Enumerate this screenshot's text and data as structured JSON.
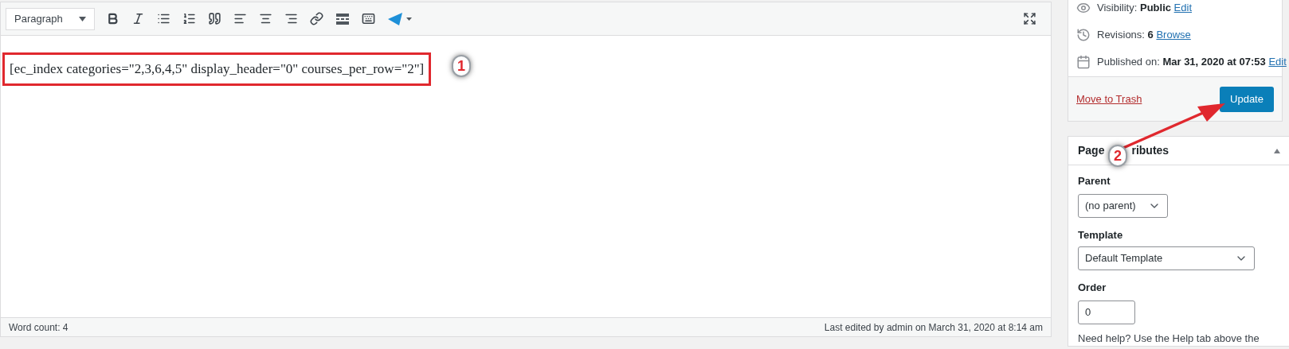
{
  "editor": {
    "format_select": "Paragraph",
    "toolbar_buttons": [
      {
        "kind": "bold"
      },
      {
        "kind": "italic"
      },
      {
        "kind": "bullets"
      },
      {
        "kind": "numbers"
      },
      {
        "kind": "quote"
      },
      {
        "kind": "align-left"
      },
      {
        "kind": "align-center"
      },
      {
        "kind": "align-right"
      },
      {
        "kind": "link"
      },
      {
        "kind": "more"
      },
      {
        "kind": "keyboard"
      },
      {
        "kind": "plugin"
      }
    ],
    "content": "[ec_index categories=\"2,3,6,4,5\" display_header=\"0\" courses_per_row=\"2\"]",
    "word_count": "Word count: 4",
    "last_edited": "Last edited by admin on March 31, 2020 at 8:14 am"
  },
  "publish": {
    "rows": [
      {
        "kind": "visibility",
        "label": "Visibility:",
        "value": "Public",
        "link": "Edit"
      },
      {
        "kind": "revisions",
        "label": "Revisions:",
        "value": "6",
        "link": "Browse"
      },
      {
        "kind": "published",
        "label": "Published on:",
        "value": "Mar 31, 2020 at 07:53",
        "link": "Edit"
      }
    ],
    "trash": "Move to Trash",
    "update": "Update"
  },
  "page_attributes": {
    "title_parts": [
      "Page",
      "ributes"
    ],
    "parent_label": "Parent",
    "parent_value": "(no parent)",
    "template_label": "Template",
    "template_value": "Default Template",
    "order_label": "Order",
    "order_value": "0",
    "help": "Need help? Use the Help tab above the"
  },
  "annotations": [
    {
      "label": "1"
    },
    {
      "label": "2"
    }
  ]
}
